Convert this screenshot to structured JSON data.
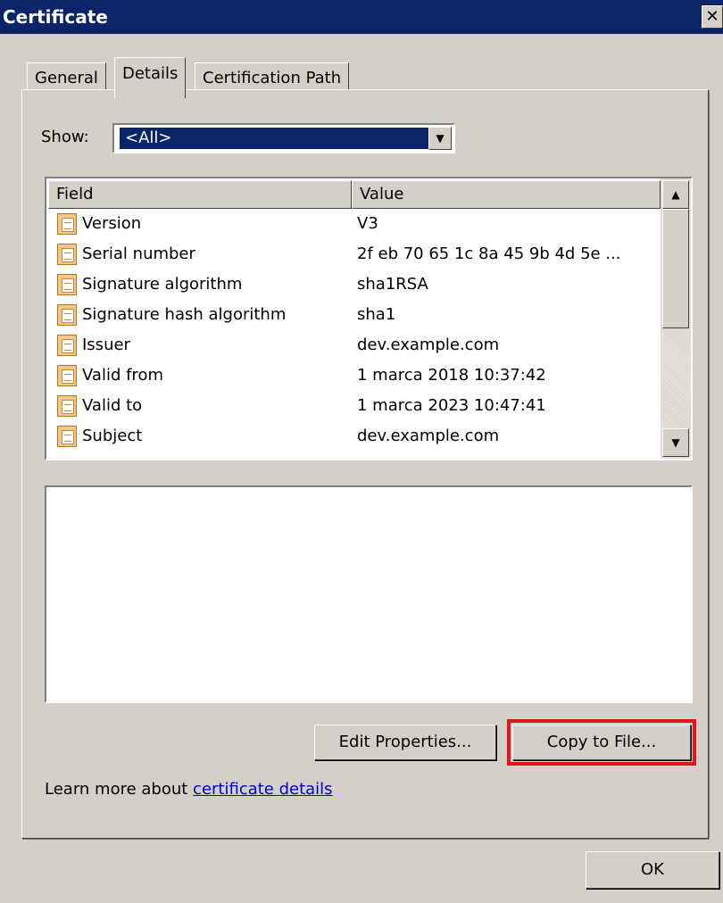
{
  "window": {
    "title": "Certificate",
    "close_glyph": "✕"
  },
  "tabs": [
    {
      "label": "General"
    },
    {
      "label": "Details",
      "active": true
    },
    {
      "label": "Certification Path"
    }
  ],
  "show": {
    "label": "Show:",
    "selected": "<All>"
  },
  "list": {
    "columns": [
      "Field",
      "Value"
    ],
    "rows": [
      {
        "field": "Version",
        "value": "V3"
      },
      {
        "field": "Serial number",
        "value": "2f eb 70 65 1c 8a 45 9b 4d 5e ..."
      },
      {
        "field": "Signature algorithm",
        "value": "sha1RSA"
      },
      {
        "field": "Signature hash algorithm",
        "value": "sha1"
      },
      {
        "field": "Issuer",
        "value": "dev.example.com"
      },
      {
        "field": "Valid from",
        "value": "1 marca 2018 10:37:42"
      },
      {
        "field": "Valid to",
        "value": "1 marca 2023 10:47:41"
      },
      {
        "field": "Subject",
        "value": "dev.example.com"
      }
    ],
    "icon": "certificate-field-icon"
  },
  "buttons": {
    "edit_properties": "Edit Properties...",
    "copy_to_file": "Copy to File...",
    "ok": "OK"
  },
  "learn_more": {
    "prefix": "Learn more about ",
    "link": "certificate details"
  },
  "colors": {
    "titlebar": "#0a246a",
    "highlight": "#e0141a",
    "face": "#d4d0c8"
  }
}
